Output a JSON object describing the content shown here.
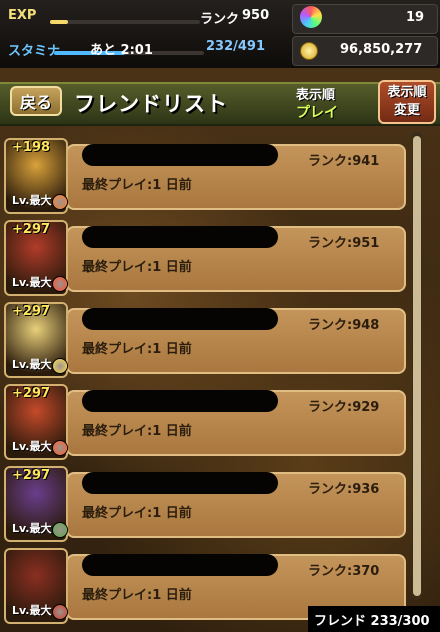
{
  "status": {
    "exp_label": "EXP",
    "exp_progress": 0.12,
    "rank_label": "ランク",
    "rank_value": "950",
    "stamina_label": "スタミナ",
    "stamina_progress": 0.47,
    "stamina_timer": "あと 2:01",
    "stamina_value": "232/491",
    "stones": "19",
    "coins": "96,850,277"
  },
  "header": {
    "back_label": "戻る",
    "title": "フレンドリスト",
    "sort_label": "表示順",
    "sort_value": "プレイ",
    "sort_button": "表示順\n変更"
  },
  "friends": [
    {
      "plus": "+198",
      "level": "Lv.最大",
      "rank": "ランク:941",
      "last_play": "最終プレイ:1 日前",
      "theme": "#d9a23a"
    },
    {
      "plus": "+297",
      "level": "Lv.最大",
      "rank": "ランク:951",
      "last_play": "最終プレイ:1 日前",
      "theme": "#b23c2a"
    },
    {
      "plus": "+297",
      "level": "Lv.最大",
      "rank": "ランク:948",
      "last_play": "最終プレイ:1 日前",
      "theme": "#e8d07a"
    },
    {
      "plus": "+297",
      "level": "Lv.最大",
      "rank": "ランク:929",
      "last_play": "最終プレイ:1 日前",
      "theme": "#c44a2a"
    },
    {
      "plus": "+297",
      "level": "Lv.最大",
      "rank": "ランク:936",
      "last_play": "最終プレイ:1 日前",
      "theme": "#6a3e8c"
    },
    {
      "plus": "",
      "level": "Lv.最大",
      "rank": "ランク:370",
      "last_play": "最終プレイ:1 日前",
      "theme": "#8a2f22"
    }
  ],
  "footer": {
    "friend_count": "フレンド 233/300"
  }
}
